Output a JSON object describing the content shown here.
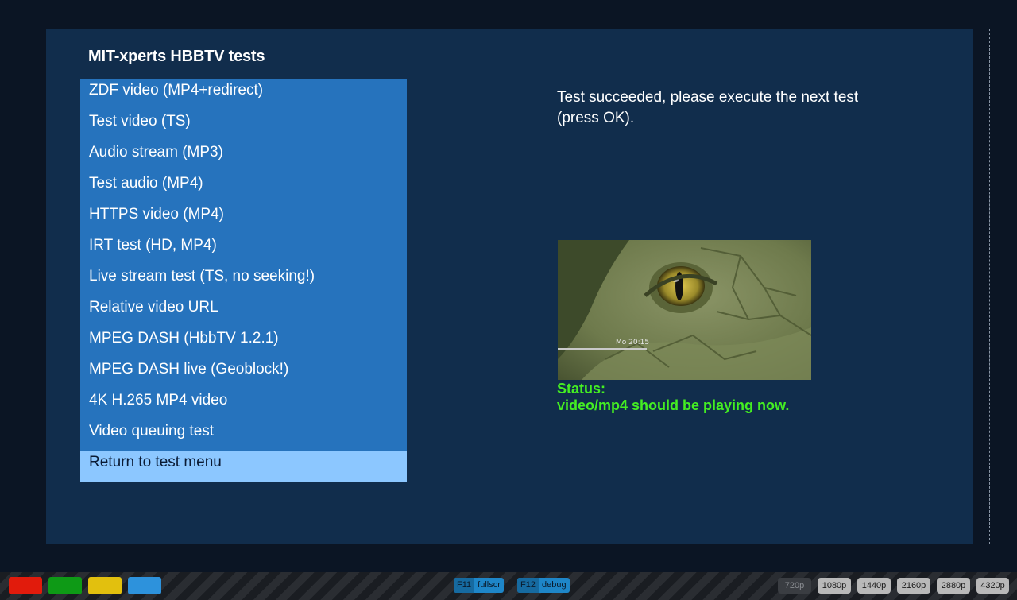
{
  "app": {
    "title": "MIT-xperts HBBTV tests"
  },
  "menu": {
    "items": [
      {
        "label": "ZDF video (MP4+redirect)"
      },
      {
        "label": "Test video (TS)"
      },
      {
        "label": "Audio stream (MP3)"
      },
      {
        "label": "Test audio (MP4)"
      },
      {
        "label": "HTTPS video (MP4)"
      },
      {
        "label": "IRT test (HD, MP4)"
      },
      {
        "label": "Live stream test (TS, no seeking!)"
      },
      {
        "label": "Relative video URL"
      },
      {
        "label": "MPEG DASH (HbbTV 1.2.1)"
      },
      {
        "label": "MPEG DASH live (Geoblock!)"
      },
      {
        "label": "4K H.265 MP4 video"
      },
      {
        "label": "Video queuing test"
      },
      {
        "label": "Return to test menu"
      }
    ],
    "selected_index": 12
  },
  "message": {
    "text": "Test succeeded, please execute the next test (press OK)."
  },
  "video": {
    "overlay_text": "Mo 20:15"
  },
  "status": {
    "label": "Status:",
    "text": "video/mp4 should be playing now."
  },
  "bottom_bar": {
    "color_buttons": [
      {
        "name": "red",
        "color": "#e11b0c"
      },
      {
        "name": "green",
        "color": "#0e9a16"
      },
      {
        "name": "yellow",
        "color": "#e2c00e"
      },
      {
        "name": "blue",
        "color": "#2d92dc"
      }
    ],
    "key_buttons": [
      {
        "key": "F11",
        "label": "fullscr"
      },
      {
        "key": "F12",
        "label": "debug"
      }
    ],
    "resolutions": [
      "720p",
      "1080p",
      "1440p",
      "2160p",
      "2880p",
      "4320p"
    ],
    "active_resolution": "720p"
  },
  "colors": {
    "background": "#0b1524",
    "screen": "#112d4c",
    "menu": "#2673bd",
    "menu_selected": "#8cc7ff",
    "status": "#44ee22"
  }
}
